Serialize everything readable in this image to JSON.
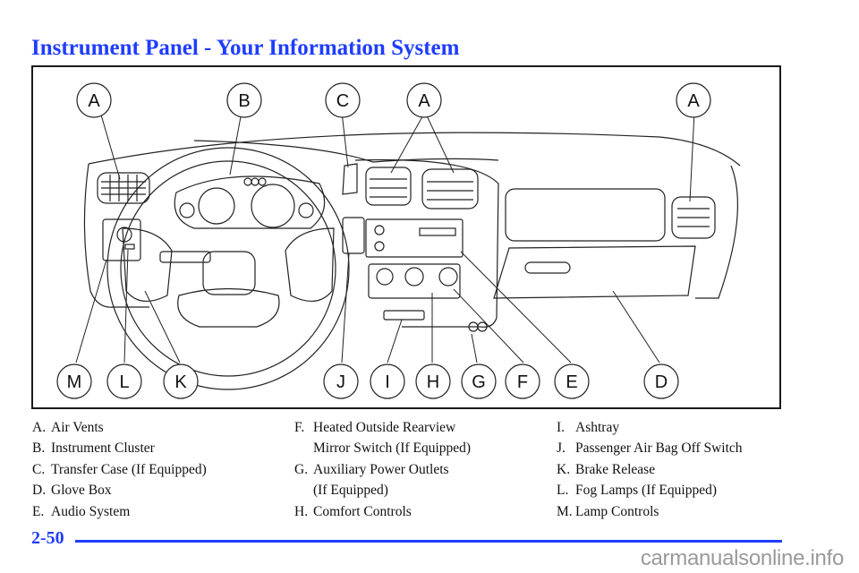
{
  "page": {
    "title": "Instrument Panel - Your Information System",
    "page_number": "2-50",
    "watermark": "carmanualsonline.info",
    "accent_color": "#1f3dff"
  },
  "figure": {
    "callouts_top": [
      "A",
      "B",
      "C",
      "A",
      "A"
    ],
    "callouts_bottom": [
      "M",
      "L",
      "K",
      "J",
      "I",
      "H",
      "G",
      "F",
      "E",
      "D"
    ]
  },
  "legend": {
    "col1": [
      {
        "letter": "A.",
        "text": "Air Vents"
      },
      {
        "letter": "B.",
        "text": "Instrument Cluster"
      },
      {
        "letter": "C.",
        "text": "Transfer Case (If Equipped)"
      },
      {
        "letter": "D.",
        "text": "Glove Box"
      },
      {
        "letter": "E.",
        "text": "Audio System"
      }
    ],
    "col2": [
      {
        "letter": "F.",
        "text": "Heated Outside Rearview",
        "text2": "Mirror Switch (If Equipped)"
      },
      {
        "letter": "G.",
        "text": "Auxiliary Power Outlets",
        "text2": "(If Equipped)"
      },
      {
        "letter": "H.",
        "text": "Comfort Controls"
      }
    ],
    "col3": [
      {
        "letter": "I.",
        "text": "Ashtray"
      },
      {
        "letter": "J.",
        "text": "Passenger Air Bag Off Switch"
      },
      {
        "letter": "K.",
        "text": "Brake Release"
      },
      {
        "letter": "L.",
        "text": "Fog Lamps (If Equipped)"
      },
      {
        "letter": "M.",
        "text": "Lamp Controls"
      }
    ]
  }
}
